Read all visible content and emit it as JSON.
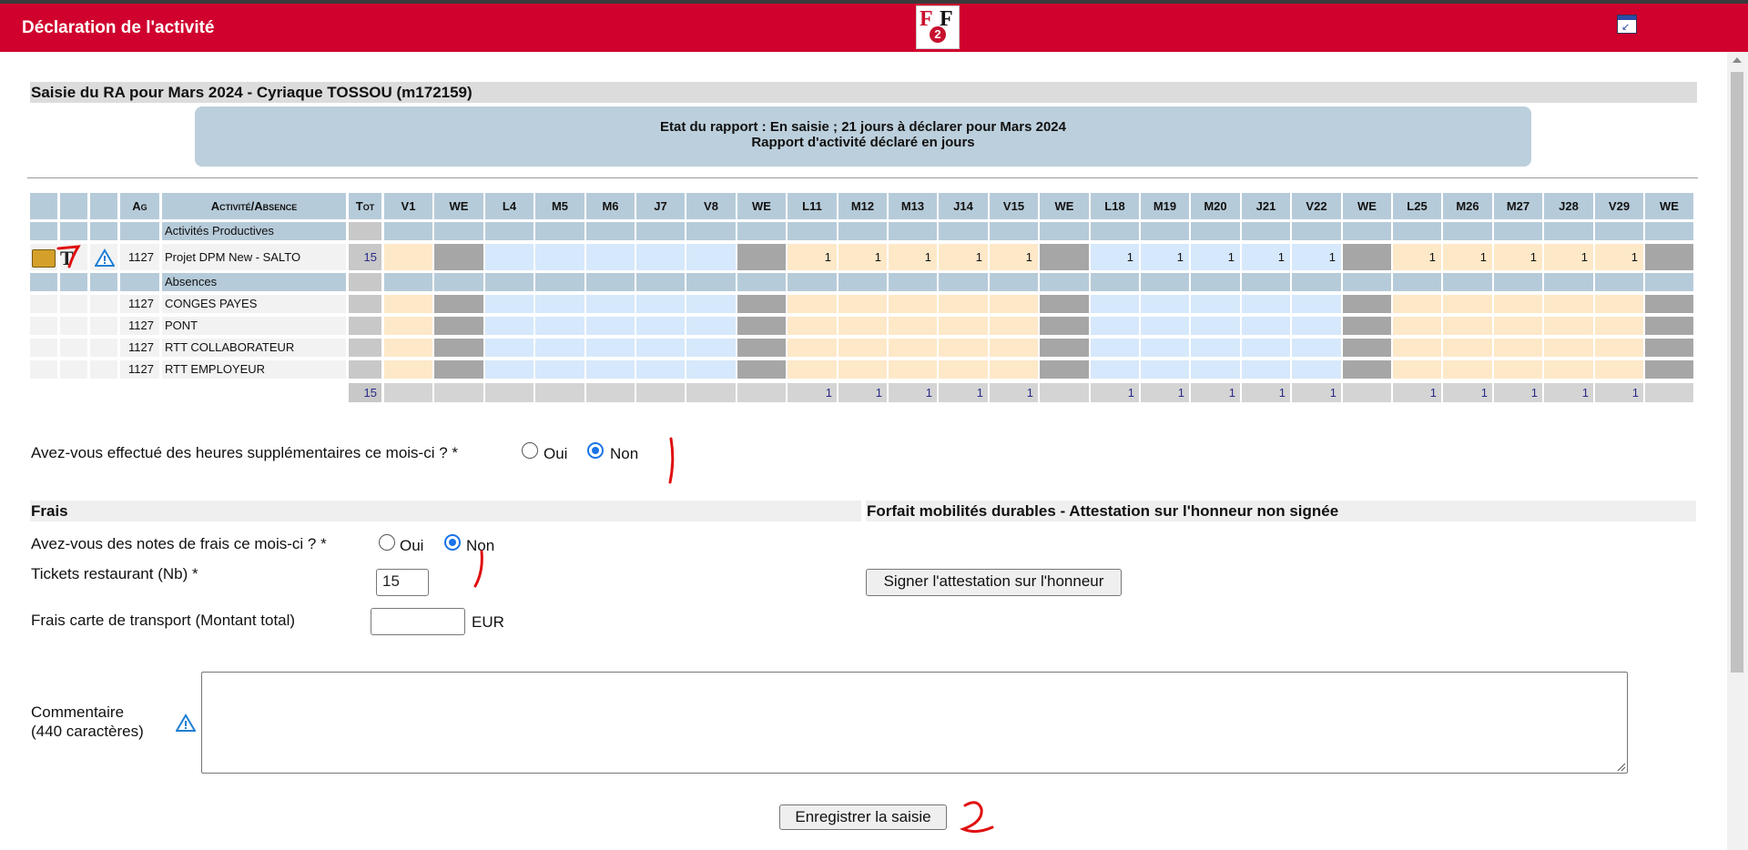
{
  "app": {
    "title": "Déclaration de l'activité"
  },
  "logo": {
    "letter1": "F",
    "digit": "2",
    "letter2": "F"
  },
  "colors": {
    "brand": "#d0012d",
    "header_cell": "#b6cbd9",
    "weekday_blue": "#d6e8fb",
    "weekday_orange": "#fde8c8",
    "weekend": "#a6a6a6",
    "status_bg": "#bccfdc"
  },
  "section": {
    "title": "Saisie du RA pour Mars 2024 - Cyriaque TOSSOU (m172159)"
  },
  "status": {
    "line1": "Etat du rapport : En saisie ; 21 jours à déclarer pour Mars 2024",
    "line2": "Rapport d'activité déclaré en jours"
  },
  "table": {
    "headers": {
      "ag": "Ag",
      "activity": "Activité/Absence",
      "tot": "Tot"
    },
    "days": [
      "V1",
      "WE",
      "L4",
      "M5",
      "M6",
      "J7",
      "V8",
      "WE",
      "L11",
      "M12",
      "M13",
      "J14",
      "V15",
      "WE",
      "L18",
      "M19",
      "M20",
      "J21",
      "V22",
      "WE",
      "L25",
      "M26",
      "M27",
      "J28",
      "V29",
      "WE"
    ],
    "groups": {
      "productive": "Activités Productives",
      "absences": "Absences"
    },
    "project_row": {
      "ag": "1127",
      "label": "Projet DPM New - SALTO",
      "total": "15",
      "values": [
        "",
        "",
        "",
        "",
        "",
        "",
        "",
        "",
        "1",
        "1",
        "1",
        "1",
        "1",
        "",
        "1",
        "1",
        "1",
        "1",
        "1",
        "",
        "1",
        "1",
        "1",
        "1",
        "1",
        ""
      ]
    },
    "absence_rows": [
      {
        "ag": "1127",
        "label": "CONGES PAYES"
      },
      {
        "ag": "1127",
        "label": "PONT"
      },
      {
        "ag": "1127",
        "label": "RTT COLLABORATEUR"
      },
      {
        "ag": "1127",
        "label": "RTT EMPLOYEUR"
      }
    ],
    "totals_row": {
      "total": "15",
      "values": [
        "",
        "",
        "",
        "",
        "",
        "",
        "",
        "",
        "1",
        "1",
        "1",
        "1",
        "1",
        "",
        "1",
        "1",
        "1",
        "1",
        "1",
        "",
        "1",
        "1",
        "1",
        "1",
        "1",
        ""
      ]
    }
  },
  "overtime": {
    "question": "Avez-vous effectué des heures supplémentaires ce mois-ci ? *",
    "oui": "Oui",
    "non": "Non",
    "selected": "Non"
  },
  "frais": {
    "title": "Frais",
    "question": "Avez-vous des notes de frais ce mois-ci ? *",
    "oui": "Oui",
    "non": "Non",
    "selected": "Non",
    "tickets_label": "Tickets restaurant (Nb) *",
    "tickets_value": "15",
    "transport_label": "Frais carte de transport (Montant total)",
    "transport_value": "",
    "currency": "EUR"
  },
  "mobility": {
    "title": "Forfait mobilités durables - Attestation sur l'honneur non signée",
    "sign_button": "Signer l'attestation sur l'honneur"
  },
  "comment": {
    "label_line1": "Commentaire",
    "label_line2": "(440 caractères)",
    "value": ""
  },
  "save_button": "Enregistrer la saisie"
}
